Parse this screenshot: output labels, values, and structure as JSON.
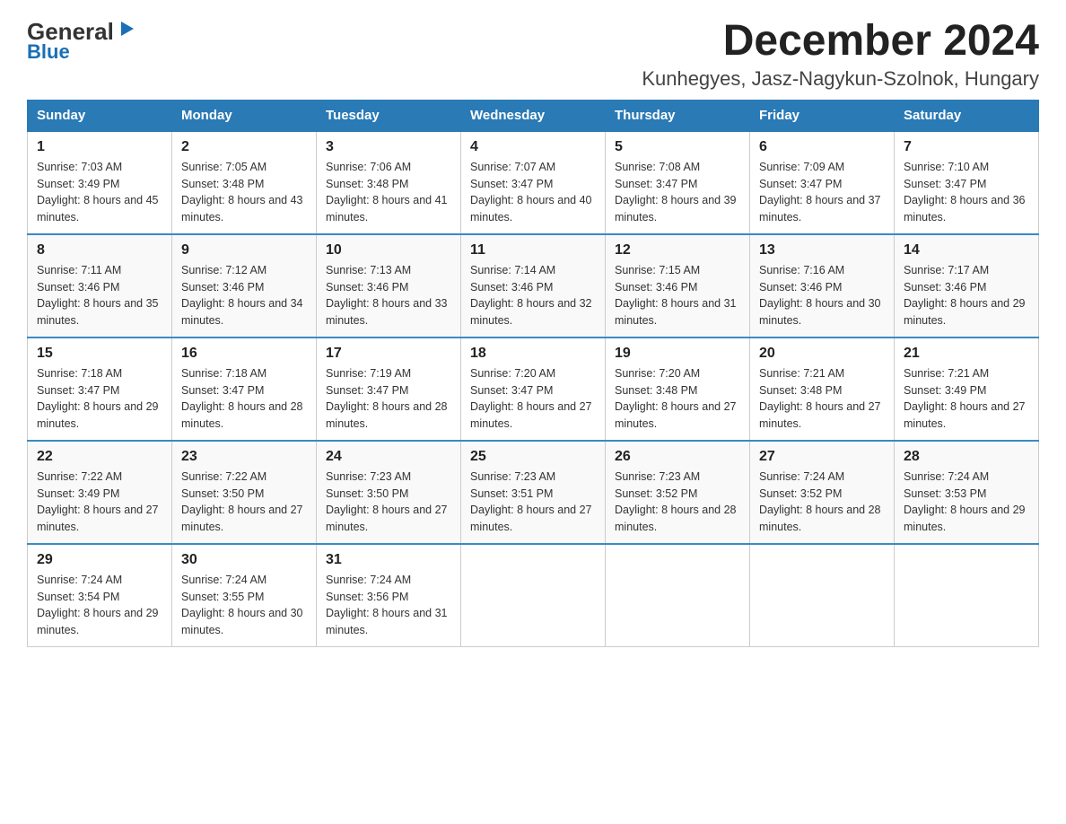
{
  "header": {
    "logo_line1": "General",
    "logo_line2": "Blue",
    "month_title": "December 2024",
    "location": "Kunhegyes, Jasz-Nagykun-Szolnok, Hungary"
  },
  "weekdays": [
    "Sunday",
    "Monday",
    "Tuesday",
    "Wednesday",
    "Thursday",
    "Friday",
    "Saturday"
  ],
  "weeks": [
    [
      {
        "day": "1",
        "sunrise": "Sunrise: 7:03 AM",
        "sunset": "Sunset: 3:49 PM",
        "daylight": "Daylight: 8 hours and 45 minutes."
      },
      {
        "day": "2",
        "sunrise": "Sunrise: 7:05 AM",
        "sunset": "Sunset: 3:48 PM",
        "daylight": "Daylight: 8 hours and 43 minutes."
      },
      {
        "day": "3",
        "sunrise": "Sunrise: 7:06 AM",
        "sunset": "Sunset: 3:48 PM",
        "daylight": "Daylight: 8 hours and 41 minutes."
      },
      {
        "day": "4",
        "sunrise": "Sunrise: 7:07 AM",
        "sunset": "Sunset: 3:47 PM",
        "daylight": "Daylight: 8 hours and 40 minutes."
      },
      {
        "day": "5",
        "sunrise": "Sunrise: 7:08 AM",
        "sunset": "Sunset: 3:47 PM",
        "daylight": "Daylight: 8 hours and 39 minutes."
      },
      {
        "day": "6",
        "sunrise": "Sunrise: 7:09 AM",
        "sunset": "Sunset: 3:47 PM",
        "daylight": "Daylight: 8 hours and 37 minutes."
      },
      {
        "day": "7",
        "sunrise": "Sunrise: 7:10 AM",
        "sunset": "Sunset: 3:47 PM",
        "daylight": "Daylight: 8 hours and 36 minutes."
      }
    ],
    [
      {
        "day": "8",
        "sunrise": "Sunrise: 7:11 AM",
        "sunset": "Sunset: 3:46 PM",
        "daylight": "Daylight: 8 hours and 35 minutes."
      },
      {
        "day": "9",
        "sunrise": "Sunrise: 7:12 AM",
        "sunset": "Sunset: 3:46 PM",
        "daylight": "Daylight: 8 hours and 34 minutes."
      },
      {
        "day": "10",
        "sunrise": "Sunrise: 7:13 AM",
        "sunset": "Sunset: 3:46 PM",
        "daylight": "Daylight: 8 hours and 33 minutes."
      },
      {
        "day": "11",
        "sunrise": "Sunrise: 7:14 AM",
        "sunset": "Sunset: 3:46 PM",
        "daylight": "Daylight: 8 hours and 32 minutes."
      },
      {
        "day": "12",
        "sunrise": "Sunrise: 7:15 AM",
        "sunset": "Sunset: 3:46 PM",
        "daylight": "Daylight: 8 hours and 31 minutes."
      },
      {
        "day": "13",
        "sunrise": "Sunrise: 7:16 AM",
        "sunset": "Sunset: 3:46 PM",
        "daylight": "Daylight: 8 hours and 30 minutes."
      },
      {
        "day": "14",
        "sunrise": "Sunrise: 7:17 AM",
        "sunset": "Sunset: 3:46 PM",
        "daylight": "Daylight: 8 hours and 29 minutes."
      }
    ],
    [
      {
        "day": "15",
        "sunrise": "Sunrise: 7:18 AM",
        "sunset": "Sunset: 3:47 PM",
        "daylight": "Daylight: 8 hours and 29 minutes."
      },
      {
        "day": "16",
        "sunrise": "Sunrise: 7:18 AM",
        "sunset": "Sunset: 3:47 PM",
        "daylight": "Daylight: 8 hours and 28 minutes."
      },
      {
        "day": "17",
        "sunrise": "Sunrise: 7:19 AM",
        "sunset": "Sunset: 3:47 PM",
        "daylight": "Daylight: 8 hours and 28 minutes."
      },
      {
        "day": "18",
        "sunrise": "Sunrise: 7:20 AM",
        "sunset": "Sunset: 3:47 PM",
        "daylight": "Daylight: 8 hours and 27 minutes."
      },
      {
        "day": "19",
        "sunrise": "Sunrise: 7:20 AM",
        "sunset": "Sunset: 3:48 PM",
        "daylight": "Daylight: 8 hours and 27 minutes."
      },
      {
        "day": "20",
        "sunrise": "Sunrise: 7:21 AM",
        "sunset": "Sunset: 3:48 PM",
        "daylight": "Daylight: 8 hours and 27 minutes."
      },
      {
        "day": "21",
        "sunrise": "Sunrise: 7:21 AM",
        "sunset": "Sunset: 3:49 PM",
        "daylight": "Daylight: 8 hours and 27 minutes."
      }
    ],
    [
      {
        "day": "22",
        "sunrise": "Sunrise: 7:22 AM",
        "sunset": "Sunset: 3:49 PM",
        "daylight": "Daylight: 8 hours and 27 minutes."
      },
      {
        "day": "23",
        "sunrise": "Sunrise: 7:22 AM",
        "sunset": "Sunset: 3:50 PM",
        "daylight": "Daylight: 8 hours and 27 minutes."
      },
      {
        "day": "24",
        "sunrise": "Sunrise: 7:23 AM",
        "sunset": "Sunset: 3:50 PM",
        "daylight": "Daylight: 8 hours and 27 minutes."
      },
      {
        "day": "25",
        "sunrise": "Sunrise: 7:23 AM",
        "sunset": "Sunset: 3:51 PM",
        "daylight": "Daylight: 8 hours and 27 minutes."
      },
      {
        "day": "26",
        "sunrise": "Sunrise: 7:23 AM",
        "sunset": "Sunset: 3:52 PM",
        "daylight": "Daylight: 8 hours and 28 minutes."
      },
      {
        "day": "27",
        "sunrise": "Sunrise: 7:24 AM",
        "sunset": "Sunset: 3:52 PM",
        "daylight": "Daylight: 8 hours and 28 minutes."
      },
      {
        "day": "28",
        "sunrise": "Sunrise: 7:24 AM",
        "sunset": "Sunset: 3:53 PM",
        "daylight": "Daylight: 8 hours and 29 minutes."
      }
    ],
    [
      {
        "day": "29",
        "sunrise": "Sunrise: 7:24 AM",
        "sunset": "Sunset: 3:54 PM",
        "daylight": "Daylight: 8 hours and 29 minutes."
      },
      {
        "day": "30",
        "sunrise": "Sunrise: 7:24 AM",
        "sunset": "Sunset: 3:55 PM",
        "daylight": "Daylight: 8 hours and 30 minutes."
      },
      {
        "day": "31",
        "sunrise": "Sunrise: 7:24 AM",
        "sunset": "Sunset: 3:56 PM",
        "daylight": "Daylight: 8 hours and 31 minutes."
      },
      null,
      null,
      null,
      null
    ]
  ]
}
